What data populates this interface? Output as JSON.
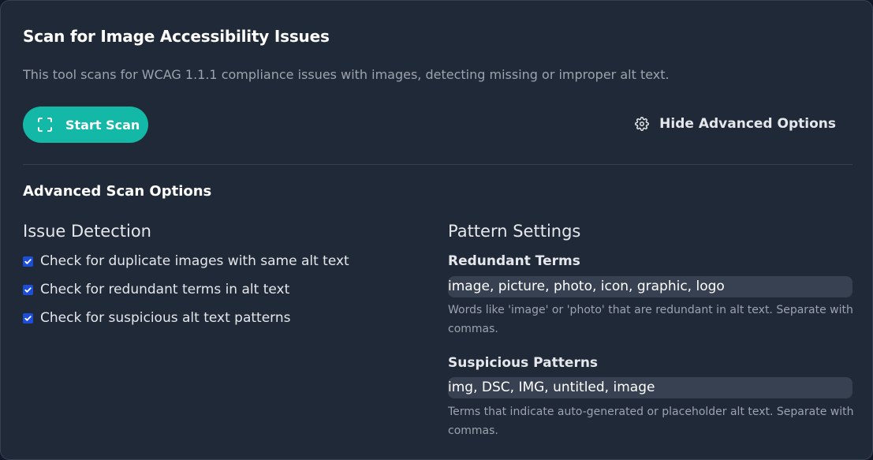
{
  "header": {
    "title": "Scan for Image Accessibility Issues",
    "description": "This tool scans for WCAG 1.1.1 compliance issues with images, detecting missing or improper alt text."
  },
  "actions": {
    "start_scan_label": "Start Scan",
    "start_scan_icon": "scan-frame-icon",
    "toggle_advanced_label": "Hide Advanced Options",
    "toggle_advanced_icon": "gear-icon"
  },
  "advanced": {
    "title": "Advanced Scan Options",
    "issue_detection": {
      "heading": "Issue Detection",
      "options": [
        {
          "label": "Check for duplicate images with same alt text",
          "checked": true
        },
        {
          "label": "Check for redundant terms in alt text",
          "checked": true
        },
        {
          "label": "Check for suspicious alt text patterns",
          "checked": true
        }
      ]
    },
    "pattern_settings": {
      "heading": "Pattern Settings",
      "redundant_terms": {
        "label": "Redundant Terms",
        "value": "image, picture, photo, icon, graphic, logo",
        "hint": "Words like 'image' or 'photo' that are redundant in alt text. Separate with commas."
      },
      "suspicious_patterns": {
        "label": "Suspicious Patterns",
        "value": "img, DSC, IMG, untitled, image",
        "hint": "Terms that indicate auto-generated or placeholder alt text. Separate with commas."
      }
    }
  },
  "colors": {
    "panel_bg": "#1f2937",
    "accent": "#14b8a6",
    "input_bg": "#374151",
    "checkbox": "#1d4ed8"
  }
}
